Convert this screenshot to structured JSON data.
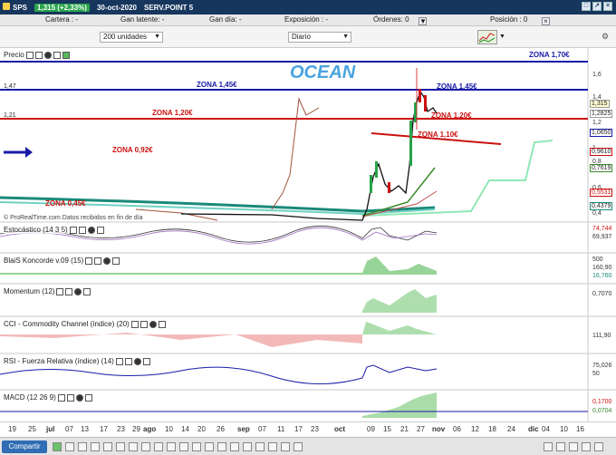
{
  "titlebar": {
    "symbol": "SPS",
    "change": "1,315 (+2,33%)",
    "date": "30-oct-2020",
    "server": "SERV.POINT 5"
  },
  "infobar": {
    "cartera": "Cartera : -",
    "ganancia_latente": "Gan latente: -",
    "ganancia_dia": "Gan día: -",
    "exposicion": "Exposición : -",
    "ordenes": "Órdenes: 0",
    "posicion": "Posición : 0"
  },
  "controls": {
    "units": "200 unidades",
    "period": "Diario"
  },
  "price_panel": {
    "label": "Precio",
    "ocean": "OCEAN",
    "zones": {
      "z170": "ZONA 1,70€",
      "z145a": "ZONA 1,45€",
      "z145b": "ZONA 1,45€",
      "z120a": "ZONA 1,20€",
      "z120b": "ZONA 1,20€",
      "z110": "ZONA 1,10€",
      "z092": "ZONA 0,92€",
      "z045": "ZONA 0,45€"
    },
    "left_levels": [
      "1,47",
      "1,21"
    ],
    "y_labels": [
      "1,6",
      "1,4",
      "1,2",
      "1",
      "0,8",
      "0,6",
      "0,4"
    ],
    "badges": [
      "1,315",
      "1,2825",
      "1,0650",
      "0,9610",
      "0,7619",
      "0,5531",
      "0,4379"
    ],
    "source": "© ProRealTime.com Datos recibidos en fin de día"
  },
  "indicators": [
    {
      "label": "Estocástico (14 3 5)",
      "values": [
        "74,744",
        "69,937"
      ]
    },
    {
      "label": "BlaiS Koncorde v.09 (15)",
      "values": [
        "500",
        "160,90",
        "16,760"
      ]
    },
    {
      "label": "Momentum (12)",
      "values": [
        "0,7070"
      ]
    },
    {
      "label": "CCI - Commodity Channel (índice) (20)",
      "values": [
        "111,90"
      ]
    },
    {
      "label": "RSI - Fuerza Relativa (índice) (14)",
      "values": [
        "75,026",
        "50"
      ]
    },
    {
      "label": "MACD (12 26 9)",
      "values": [
        "0,1700",
        "0,0704"
      ]
    }
  ],
  "date_axis": [
    "19",
    "25",
    "jul",
    "07",
    "13",
    "17",
    "23",
    "29",
    "ago",
    "10",
    "14",
    "20",
    "26",
    "sep",
    "07",
    "11",
    "17",
    "23",
    "oct",
    "09",
    "15",
    "21",
    "27",
    "nov",
    "06",
    "12",
    "18",
    "24",
    "dic",
    "04",
    "10",
    "16"
  ],
  "bottombar": {
    "share": "Compartir"
  },
  "colors": {
    "titlebar": "#17365d",
    "change": "#27a44a",
    "zone_blue": "#1a1aa8",
    "zone_red": "#cc1111",
    "ocean": "#4aa3df"
  }
}
